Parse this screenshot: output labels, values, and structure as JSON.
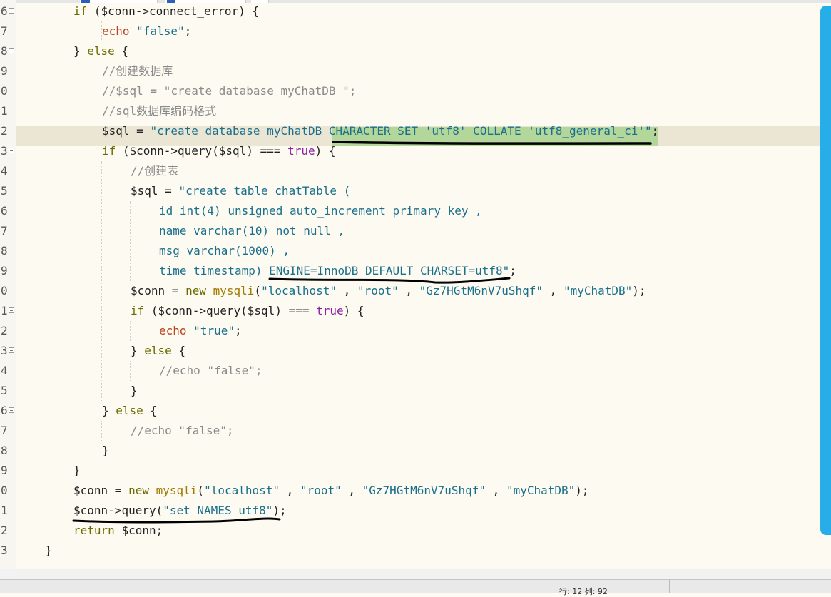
{
  "editor": {
    "first_line_number": 6,
    "lines": [
      {
        "num": "6",
        "fold": true,
        "indent": 2,
        "tokens": [
          [
            "kw",
            "if"
          ],
          [
            "op",
            " ("
          ],
          [
            "var",
            "$conn"
          ],
          [
            "op",
            "->"
          ],
          [
            "var",
            "connect_error"
          ],
          [
            "op",
            ") {"
          ]
        ]
      },
      {
        "num": "7",
        "fold": false,
        "indent": 3,
        "tokens": [
          [
            "echo",
            "echo"
          ],
          [
            "op",
            " "
          ],
          [
            "str",
            "\"false\""
          ],
          [
            "op",
            ";"
          ]
        ]
      },
      {
        "num": "8",
        "fold": true,
        "indent": 2,
        "tokens": [
          [
            "op",
            "} "
          ],
          [
            "kw",
            "else"
          ],
          [
            "op",
            " {"
          ]
        ]
      },
      {
        "num": "9",
        "fold": false,
        "indent": 3,
        "tokens": [
          [
            "cmt",
            "//创建数据库"
          ]
        ]
      },
      {
        "num": "0",
        "fold": false,
        "indent": 3,
        "tokens": [
          [
            "cmt",
            "//$sql = \"create database myChatDB \";"
          ]
        ]
      },
      {
        "num": "1",
        "fold": false,
        "indent": 3,
        "tokens": [
          [
            "cmt",
            "//sql数据库编码格式"
          ]
        ]
      },
      {
        "num": "2",
        "fold": false,
        "indent": 3,
        "tokens": [
          [
            "var",
            "$sql"
          ],
          [
            "op",
            " = "
          ],
          [
            "str",
            "\"create database myChatDB CHARACTER SET 'utf8' COLLATE 'utf8_general_ci'\""
          ],
          [
            "op",
            ";"
          ]
        ]
      },
      {
        "num": "3",
        "fold": true,
        "indent": 3,
        "tokens": [
          [
            "kw",
            "if"
          ],
          [
            "op",
            " ("
          ],
          [
            "var",
            "$conn"
          ],
          [
            "op",
            "->"
          ],
          [
            "var",
            "query"
          ],
          [
            "op",
            "("
          ],
          [
            "var",
            "$sql"
          ],
          [
            "op",
            ") === "
          ],
          [
            "bool",
            "true"
          ],
          [
            "op",
            ") {"
          ]
        ]
      },
      {
        "num": "4",
        "fold": false,
        "indent": 4,
        "tokens": [
          [
            "cmt",
            "//创建表"
          ]
        ]
      },
      {
        "num": "5",
        "fold": false,
        "indent": 4,
        "tokens": [
          [
            "var",
            "$sql"
          ],
          [
            "op",
            " = "
          ],
          [
            "str",
            "\"create table chatTable ("
          ]
        ]
      },
      {
        "num": "6",
        "fold": false,
        "indent": 5,
        "tokens": [
          [
            "str",
            "id int(4) unsigned auto_increment primary key ,"
          ]
        ]
      },
      {
        "num": "7",
        "fold": false,
        "indent": 5,
        "tokens": [
          [
            "str",
            "name varchar(10) not null ,"
          ]
        ]
      },
      {
        "num": "8",
        "fold": false,
        "indent": 5,
        "tokens": [
          [
            "str",
            "msg varchar(1000) ,"
          ]
        ]
      },
      {
        "num": "9",
        "fold": false,
        "indent": 5,
        "tokens": [
          [
            "str",
            "time timestamp) ENGINE=InnoDB DEFAULT CHARSET=utf8\""
          ],
          [
            "op",
            ";"
          ]
        ]
      },
      {
        "num": "0",
        "fold": false,
        "indent": 4,
        "tokens": [
          [
            "var",
            "$conn"
          ],
          [
            "op",
            " = "
          ],
          [
            "kw",
            "new"
          ],
          [
            "op",
            " "
          ],
          [
            "kw2",
            "mysqli"
          ],
          [
            "op",
            "("
          ],
          [
            "str",
            "\"localhost\""
          ],
          [
            "op",
            " , "
          ],
          [
            "str",
            "\"root\""
          ],
          [
            "op",
            " , "
          ],
          [
            "str",
            "\"Gz7HGtM6nV7uShqf\""
          ],
          [
            "op",
            " , "
          ],
          [
            "str",
            "\"myChatDB\""
          ],
          [
            "op",
            ");"
          ]
        ]
      },
      {
        "num": "1",
        "fold": true,
        "indent": 4,
        "tokens": [
          [
            "kw",
            "if"
          ],
          [
            "op",
            " ("
          ],
          [
            "var",
            "$conn"
          ],
          [
            "op",
            "->"
          ],
          [
            "var",
            "query"
          ],
          [
            "op",
            "("
          ],
          [
            "var",
            "$sql"
          ],
          [
            "op",
            ") === "
          ],
          [
            "bool",
            "true"
          ],
          [
            "op",
            ") {"
          ]
        ]
      },
      {
        "num": "2",
        "fold": false,
        "indent": 5,
        "tokens": [
          [
            "echo",
            "echo"
          ],
          [
            "op",
            " "
          ],
          [
            "str",
            "\"true\""
          ],
          [
            "op",
            ";"
          ]
        ]
      },
      {
        "num": "3",
        "fold": true,
        "indent": 4,
        "tokens": [
          [
            "op",
            "} "
          ],
          [
            "kw",
            "else"
          ],
          [
            "op",
            " {"
          ]
        ]
      },
      {
        "num": "4",
        "fold": false,
        "indent": 5,
        "tokens": [
          [
            "cmt",
            "//echo \"false\";"
          ]
        ]
      },
      {
        "num": "5",
        "fold": false,
        "indent": 4,
        "tokens": [
          [
            "op",
            "}"
          ]
        ]
      },
      {
        "num": "6",
        "fold": true,
        "indent": 3,
        "tokens": [
          [
            "op",
            "} "
          ],
          [
            "kw",
            "else"
          ],
          [
            "op",
            " {"
          ]
        ]
      },
      {
        "num": "7",
        "fold": false,
        "indent": 4,
        "tokens": [
          [
            "cmt",
            "//echo \"false\";"
          ]
        ]
      },
      {
        "num": "8",
        "fold": false,
        "indent": 3,
        "tokens": [
          [
            "op",
            "}"
          ]
        ]
      },
      {
        "num": "9",
        "fold": false,
        "indent": 2,
        "tokens": [
          [
            "op",
            "}"
          ]
        ]
      },
      {
        "num": "0",
        "fold": false,
        "indent": 2,
        "tokens": [
          [
            "var",
            "$conn"
          ],
          [
            "op",
            " = "
          ],
          [
            "kw",
            "new"
          ],
          [
            "op",
            " "
          ],
          [
            "kw2",
            "mysqli"
          ],
          [
            "op",
            "("
          ],
          [
            "str",
            "\"localhost\""
          ],
          [
            "op",
            " , "
          ],
          [
            "str",
            "\"root\""
          ],
          [
            "op",
            " , "
          ],
          [
            "str",
            "\"Gz7HGtM6nV7uShqf\""
          ],
          [
            "op",
            " , "
          ],
          [
            "str",
            "\"myChatDB\""
          ],
          [
            "op",
            ");"
          ]
        ]
      },
      {
        "num": "1",
        "fold": false,
        "indent": 2,
        "tokens": [
          [
            "var",
            "$conn"
          ],
          [
            "op",
            "->"
          ],
          [
            "var",
            "query"
          ],
          [
            "op",
            "("
          ],
          [
            "str",
            "\"set NAMES utf8\""
          ],
          [
            "op",
            ");"
          ]
        ]
      },
      {
        "num": "2",
        "fold": false,
        "indent": 2,
        "tokens": [
          [
            "kw",
            "return"
          ],
          [
            "op",
            " "
          ],
          [
            "var",
            "$conn"
          ],
          [
            "op",
            ";"
          ]
        ]
      },
      {
        "num": "3",
        "fold": false,
        "indent": 1,
        "tokens": [
          [
            "op",
            "}"
          ]
        ]
      }
    ]
  },
  "status": {
    "position_text": "行: 12 列: 92"
  },
  "colors": {
    "background": "#fdfbf1",
    "current_line": "#ebe6d4",
    "selection": "#b3d69a",
    "side_panel": "#27aee8",
    "annotation_ink": "#000000"
  }
}
